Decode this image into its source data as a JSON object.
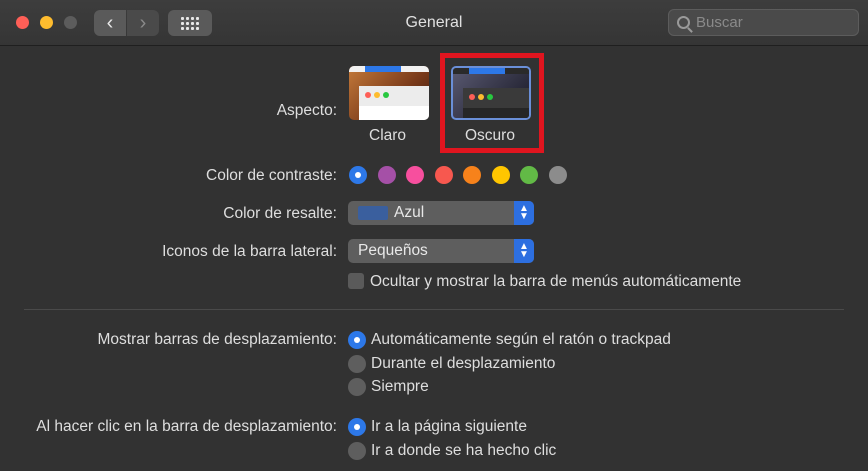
{
  "window": {
    "title": "General"
  },
  "toolbar": {
    "back_icon": "chevron-left-icon",
    "forward_icon": "chevron-right-icon",
    "grid_icon": "show-all-grid-icon"
  },
  "search": {
    "placeholder": "Buscar"
  },
  "appearance": {
    "label": "Aspecto:",
    "options": [
      {
        "label": "Claro",
        "selected": false
      },
      {
        "label": "Oscuro",
        "selected": true
      }
    ]
  },
  "accent": {
    "label": "Color de contraste:",
    "colors": [
      "#2d78e8",
      "#a550a7",
      "#f74f9e",
      "#f7584f",
      "#f7821b",
      "#ffc600",
      "#62ba46",
      "#8c8c8c"
    ],
    "selected_index": 0
  },
  "highlight": {
    "label": "Color de resalte:",
    "value": "Azul",
    "chip_color": "#3a5f9e"
  },
  "sidebar_icons": {
    "label": "Iconos de la barra lateral:",
    "value": "Pequeños"
  },
  "menubar_toggle": {
    "label": "Ocultar y mostrar la barra de menús automáticamente",
    "checked": false
  },
  "scrollbars": {
    "label": "Mostrar barras de desplazamiento:",
    "options": [
      {
        "label": "Automáticamente según el ratón o trackpad",
        "selected": true
      },
      {
        "label": "Durante el desplazamiento",
        "selected": false
      },
      {
        "label": "Siempre",
        "selected": false
      }
    ]
  },
  "scroll_click": {
    "label": "Al hacer clic en la barra de desplazamiento:",
    "options": [
      {
        "label": "Ir a la página siguiente",
        "selected": true
      },
      {
        "label": "Ir a donde se ha hecho clic",
        "selected": false
      }
    ]
  }
}
